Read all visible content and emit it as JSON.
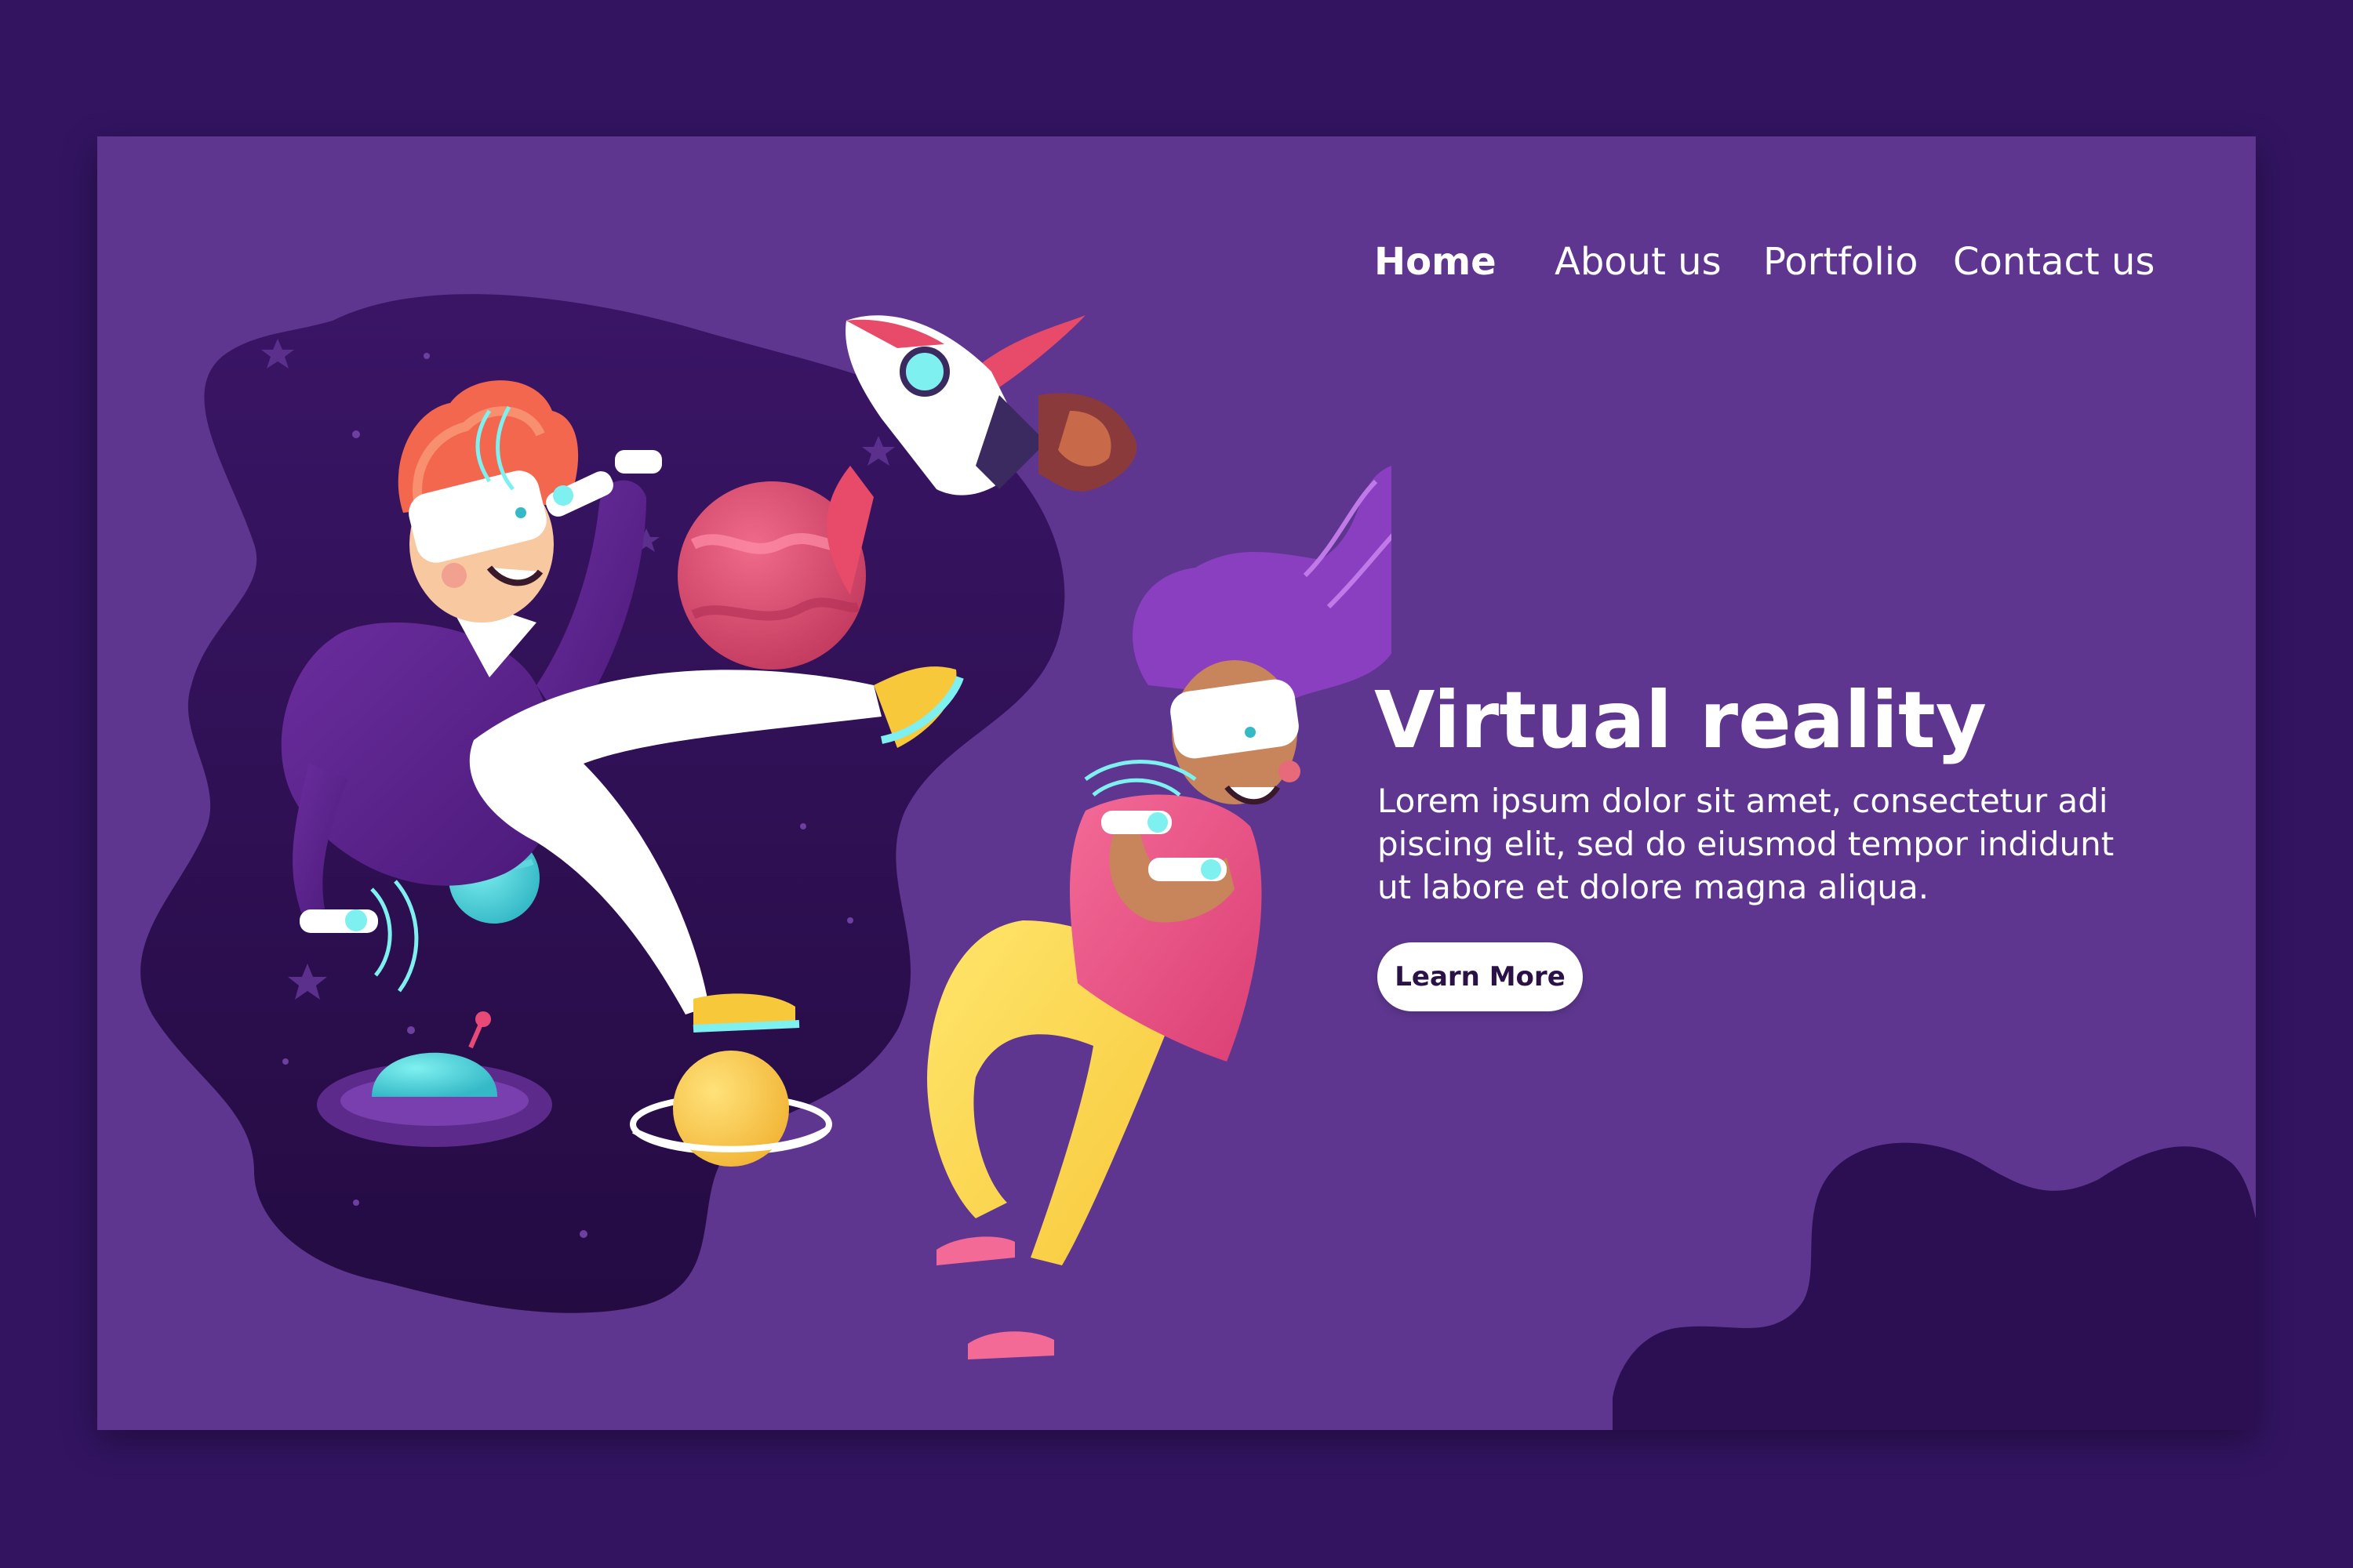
{
  "nav": {
    "items": [
      {
        "label": "Home",
        "active": true
      },
      {
        "label": "About us",
        "active": false
      },
      {
        "label": "Portfolio",
        "active": false
      },
      {
        "label": "Contact us",
        "active": false
      }
    ]
  },
  "hero": {
    "title": "Virtual reality",
    "body_lines": [
      "Lorem ipsum dolor sit amet, consectetur adi",
      "piscing elit, sed do eiusmod tempor indidunt",
      "ut labore et dolore magna aliqua."
    ],
    "cta_label": "Learn More"
  },
  "colors": {
    "outer_background": "#321461",
    "frame_background": "#5e368f",
    "space_blob": "#2a0f4c",
    "button_background": "#ffffff",
    "button_text": "#2a1146"
  },
  "icons": [
    "rocket-icon",
    "planet-icon",
    "ufo-icon",
    "star-icon",
    "vr-headset-icon",
    "vr-controller-icon"
  ]
}
